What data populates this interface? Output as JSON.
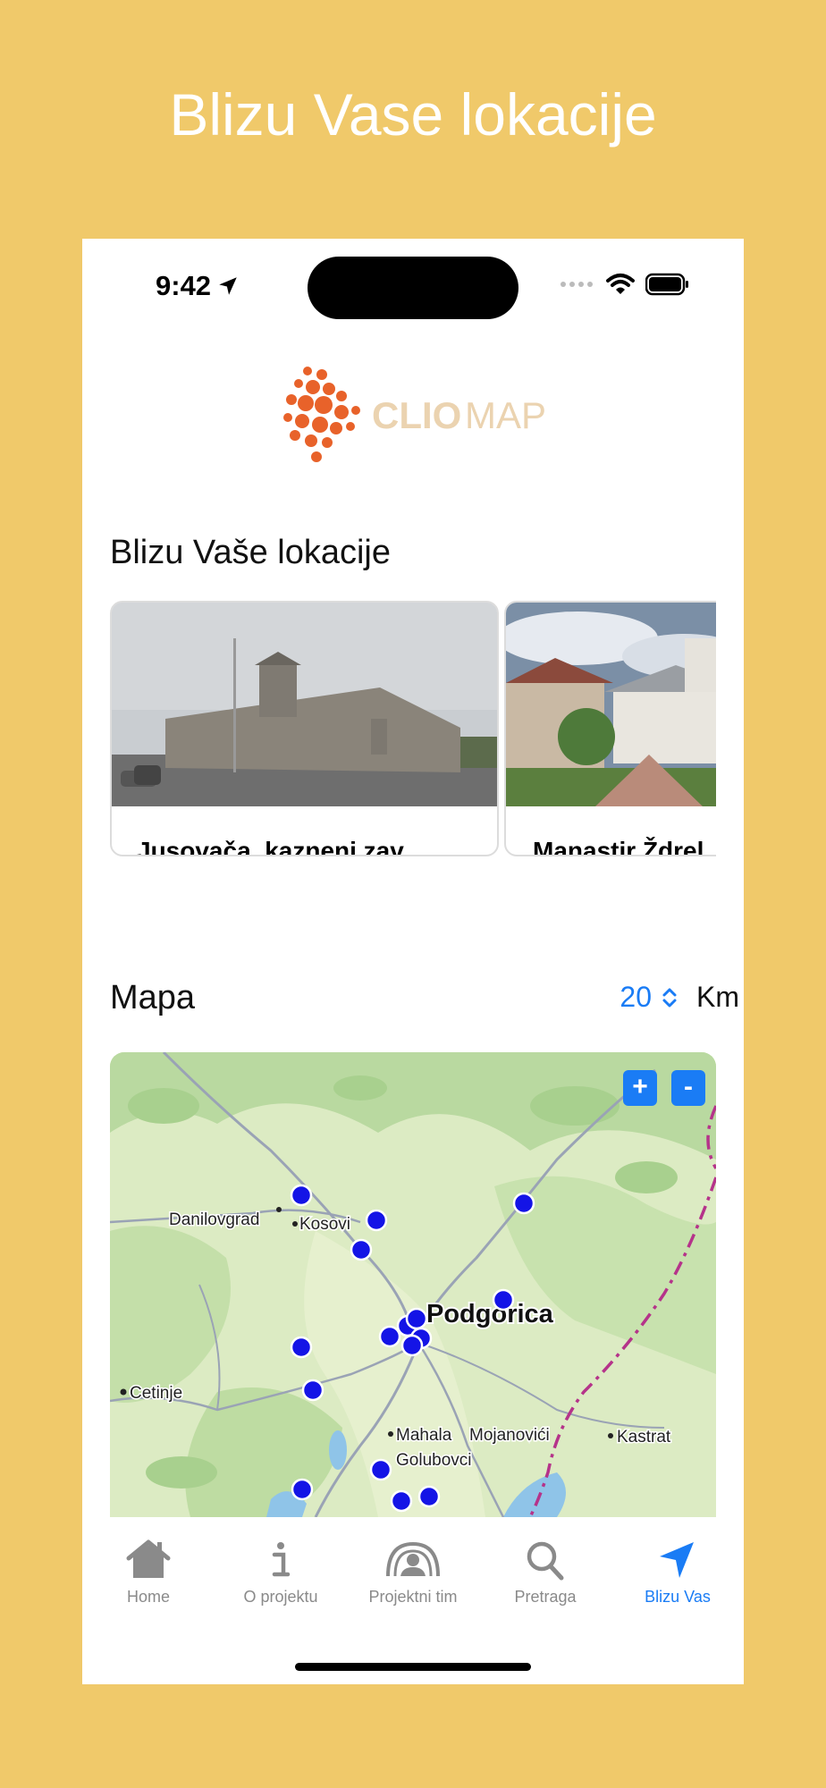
{
  "banner": {
    "title": "Blizu Vase lokacije"
  },
  "status_bar": {
    "time": "9:42"
  },
  "logo": {
    "brand_first": "CLIO",
    "brand_second": "MAP",
    "dot_color": "#E8622A"
  },
  "nearby": {
    "section_title": "Blizu Vaše lokacije",
    "cards": [
      {
        "title": "Jusovača, kazneni zav..."
      },
      {
        "title": "Manastir Ždrel"
      }
    ]
  },
  "map_section": {
    "title": "Mapa",
    "radius_value": "20",
    "radius_unit": "Km",
    "zoom_in": "+",
    "zoom_out": "-",
    "labels": {
      "danilovgrad": "Danilovgrad",
      "kosovi": "Kosovi",
      "podgorica": "Podgorica",
      "cetinje": "Cetinje",
      "mahala": "Mahala",
      "mojanovici": "Mojanovići",
      "golubovci": "Golubovci",
      "kastrat": "Kastrat"
    },
    "marker_color": "#1414E6"
  },
  "tabbar": {
    "items": [
      {
        "label": "Home",
        "icon": "house-icon"
      },
      {
        "label": "O projektu",
        "icon": "info-icon"
      },
      {
        "label": "Projektni tim",
        "icon": "team-icon"
      },
      {
        "label": "Pretraga",
        "icon": "search-icon"
      },
      {
        "label": "Blizu Vas",
        "icon": "location-arrow-icon"
      }
    ],
    "active_index": 4,
    "accent": "#1A7CF5"
  }
}
